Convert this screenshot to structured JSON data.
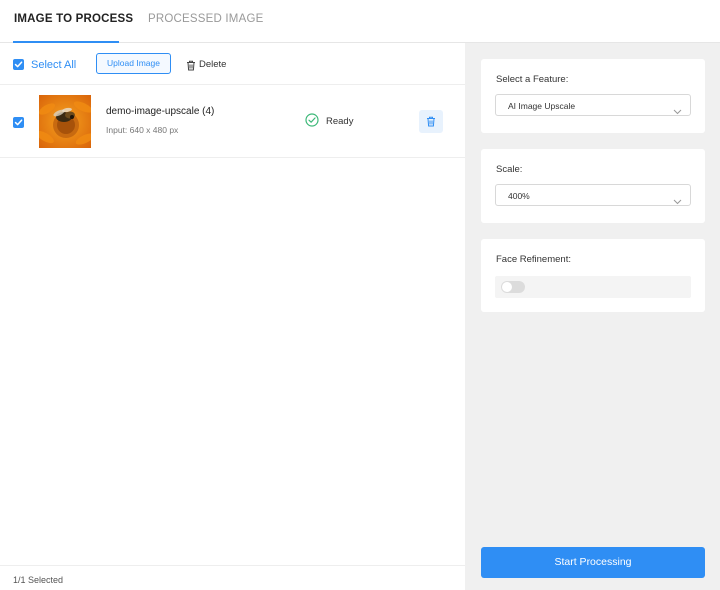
{
  "tabs": {
    "image_to_process": "IMAGE TO PROCESS",
    "processed_image": "PROCESSED IMAGE"
  },
  "toolbar": {
    "select_all_label": "Select All",
    "select_all_checked": true,
    "upload_label": "Upload Image",
    "delete_label": "Delete",
    "delete_icon": "trash-icon"
  },
  "images": [
    {
      "checked": true,
      "thumbnail": "bee-on-orange-flower",
      "name": "demo-image-upscale (4)",
      "size": "Input: 640 x 480 px",
      "status": "Ready",
      "status_icon": "check-circle-icon",
      "delete_icon": "trash-icon"
    }
  ],
  "footer": {
    "selected_text": "1/1 Selected"
  },
  "settings": {
    "feature_label": "Select a Feature:",
    "feature_value": "AI Image Upscale",
    "scale_label": "Scale:",
    "scale_value": "400%",
    "face_label": "Face Refinement:",
    "face_enabled": false
  },
  "start_button": "Start Processing",
  "colors": {
    "accent": "#2f8ef4",
    "ready_green": "#3cb878",
    "panel_bg": "#f0f0f0"
  }
}
